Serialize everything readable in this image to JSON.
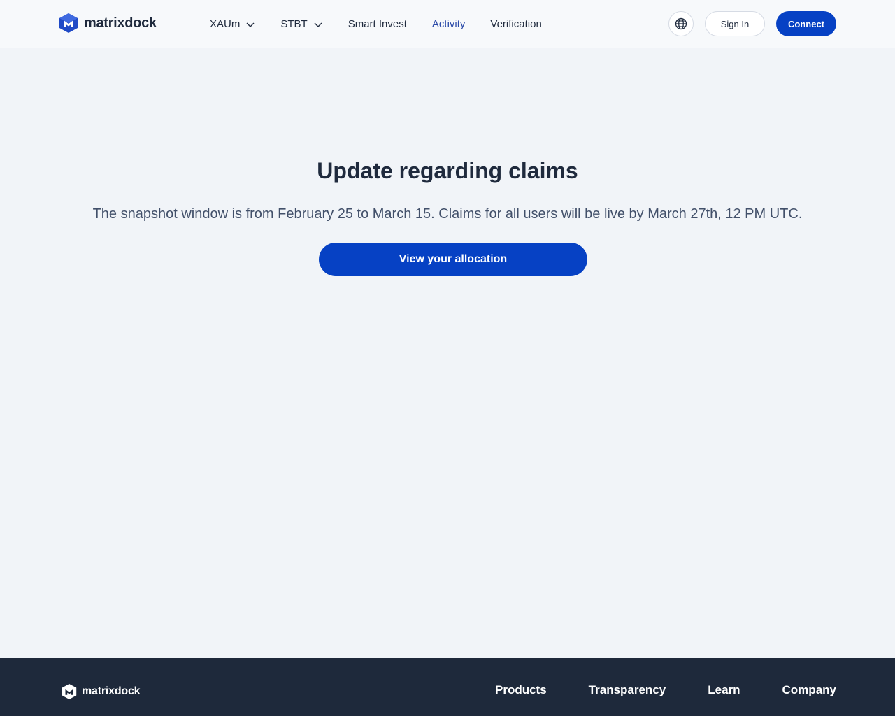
{
  "header": {
    "logo_text": "matrixdock",
    "nav": [
      {
        "label": "XAUm",
        "has_dropdown": true
      },
      {
        "label": "STBT",
        "has_dropdown": true
      },
      {
        "label": "Smart Invest",
        "has_dropdown": false
      },
      {
        "label": "Activity",
        "has_dropdown": false,
        "active": true
      },
      {
        "label": "Verification",
        "has_dropdown": false
      }
    ],
    "language_icon": "globe-icon",
    "signin_label": "Sign In",
    "connect_label": "Connect"
  },
  "main": {
    "title": "Update regarding claims",
    "description": "The snapshot window is from February 25 to March 15. Claims for all users will be live by March 27th, 12 PM UTC.",
    "cta_label": "View your allocation"
  },
  "footer": {
    "logo_text": "matrixdock",
    "links": [
      "Products",
      "Transparency",
      "Learn",
      "Company"
    ]
  },
  "colors": {
    "accent": "#0641c4",
    "active_nav": "#2a4aa8",
    "footer_bg": "#1e293b",
    "page_bg": "#f1f4f8"
  }
}
